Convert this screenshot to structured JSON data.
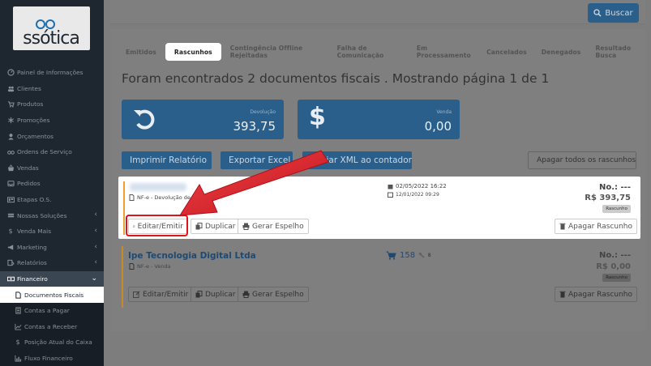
{
  "brand": {
    "logo_text": "ssótica"
  },
  "sidebar": {
    "items": [
      {
        "icon": "dashboard-icon",
        "label": "Painel de Informações"
      },
      {
        "icon": "users-icon",
        "label": "Clientes"
      },
      {
        "icon": "cart-icon",
        "label": "Produtos"
      },
      {
        "icon": "asterisk-icon",
        "label": "Promoções"
      },
      {
        "icon": "calculator-icon",
        "label": "Orçamentos"
      },
      {
        "icon": "glasses-icon",
        "label": "Ordens de Serviço"
      },
      {
        "icon": "basket-icon",
        "label": "Vendas"
      },
      {
        "icon": "inbox-icon",
        "label": "Pedidos"
      },
      {
        "icon": "board-icon",
        "label": "Etapas O.S."
      },
      {
        "icon": "layers-icon",
        "label": "Nossas Soluções"
      },
      {
        "icon": "dollar-icon",
        "label": "Venda Mais"
      },
      {
        "icon": "megaphone-icon",
        "label": "Marketing"
      },
      {
        "icon": "report-icon",
        "label": "Relatórios"
      },
      {
        "icon": "money-icon",
        "label": "Financeiro"
      }
    ],
    "subitems": [
      {
        "icon": "document-icon",
        "label": "Documentos Fiscais"
      },
      {
        "icon": "ledger-icon",
        "label": "Contas a Pagar"
      },
      {
        "icon": "chart-line-icon",
        "label": "Contas a Receber"
      },
      {
        "icon": "dollar-icon",
        "label": "Posição Atual do Caixa"
      },
      {
        "icon": "bar-chart-icon",
        "label": "Fluxo Financeiro"
      }
    ]
  },
  "header": {
    "search_label": "Buscar"
  },
  "tabs": [
    "Emitidos",
    "Rascunhos",
    "Contingência Offline Rejeitadas",
    "Falha de Comunicação",
    "Em Processamento",
    "Cancelados",
    "Denegados",
    "Resultado Busca"
  ],
  "active_tab": "Rascunhos",
  "summary": "Foram encontrados 2 documentos fiscais . Mostrando página 1 de 1",
  "stats": [
    {
      "label": "Devolução",
      "value": "393,75",
      "icon": "undo-icon"
    },
    {
      "label": "Venda",
      "value": "0,00",
      "icon": "dollar-icon"
    }
  ],
  "actions": {
    "print": "Imprimir Relatório",
    "excel": "Exportar Excel",
    "xml": "Enviar XML ao contador",
    "delete_all": "Apagar todos os rascunhos"
  },
  "documents": [
    {
      "type": "NF-e - Devolução de Compra",
      "date_main": "02/05/2022 16:22",
      "date_sub": "12/01/2022 09:29",
      "number": "No.: ---",
      "amount": "R$ 393,75",
      "status": "Rascunho",
      "btn_edit": "Editar/Emitir",
      "btn_dup": "Duplicar",
      "btn_mirror": "Gerar Espelho",
      "btn_delete": "Apagar Rascunho"
    },
    {
      "customer": "Ipe Tecnologia Digital Ltda",
      "type": "NF-e - Venda",
      "items_count": "158",
      "tools_count": "8",
      "number": "No.: ---",
      "amount": "R$ 0,00",
      "status": "Rascunho",
      "btn_edit": "Editar/Emitir",
      "btn_dup": "Duplicar",
      "btn_mirror": "Gerar Espelho",
      "btn_delete": "Apagar Rascunho"
    }
  ],
  "colors": {
    "primary": "#2a5f8c",
    "sidebar": "#1e2730",
    "highlight": "#e0141b",
    "accent_bar": "#f0a030"
  }
}
